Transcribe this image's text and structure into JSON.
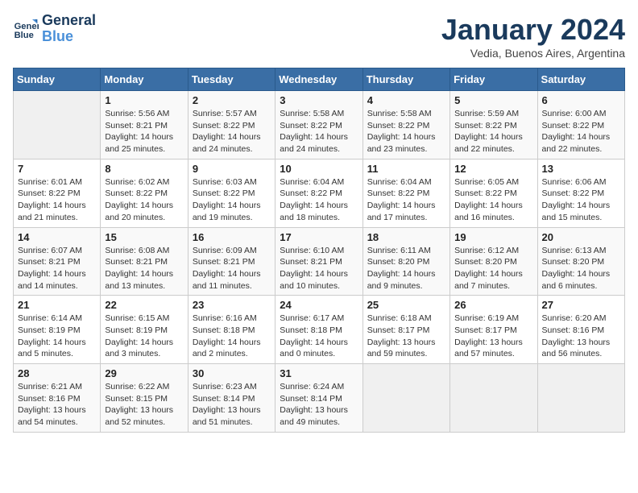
{
  "header": {
    "logo_line1": "General",
    "logo_line2": "Blue",
    "month": "January 2024",
    "location": "Vedia, Buenos Aires, Argentina"
  },
  "weekdays": [
    "Sunday",
    "Monday",
    "Tuesday",
    "Wednesday",
    "Thursday",
    "Friday",
    "Saturday"
  ],
  "weeks": [
    [
      {
        "day": "",
        "info": ""
      },
      {
        "day": "1",
        "info": "Sunrise: 5:56 AM\nSunset: 8:21 PM\nDaylight: 14 hours\nand 25 minutes."
      },
      {
        "day": "2",
        "info": "Sunrise: 5:57 AM\nSunset: 8:22 PM\nDaylight: 14 hours\nand 24 minutes."
      },
      {
        "day": "3",
        "info": "Sunrise: 5:58 AM\nSunset: 8:22 PM\nDaylight: 14 hours\nand 24 minutes."
      },
      {
        "day": "4",
        "info": "Sunrise: 5:58 AM\nSunset: 8:22 PM\nDaylight: 14 hours\nand 23 minutes."
      },
      {
        "day": "5",
        "info": "Sunrise: 5:59 AM\nSunset: 8:22 PM\nDaylight: 14 hours\nand 22 minutes."
      },
      {
        "day": "6",
        "info": "Sunrise: 6:00 AM\nSunset: 8:22 PM\nDaylight: 14 hours\nand 22 minutes."
      }
    ],
    [
      {
        "day": "7",
        "info": "Sunrise: 6:01 AM\nSunset: 8:22 PM\nDaylight: 14 hours\nand 21 minutes."
      },
      {
        "day": "8",
        "info": "Sunrise: 6:02 AM\nSunset: 8:22 PM\nDaylight: 14 hours\nand 20 minutes."
      },
      {
        "day": "9",
        "info": "Sunrise: 6:03 AM\nSunset: 8:22 PM\nDaylight: 14 hours\nand 19 minutes."
      },
      {
        "day": "10",
        "info": "Sunrise: 6:04 AM\nSunset: 8:22 PM\nDaylight: 14 hours\nand 18 minutes."
      },
      {
        "day": "11",
        "info": "Sunrise: 6:04 AM\nSunset: 8:22 PM\nDaylight: 14 hours\nand 17 minutes."
      },
      {
        "day": "12",
        "info": "Sunrise: 6:05 AM\nSunset: 8:22 PM\nDaylight: 14 hours\nand 16 minutes."
      },
      {
        "day": "13",
        "info": "Sunrise: 6:06 AM\nSunset: 8:22 PM\nDaylight: 14 hours\nand 15 minutes."
      }
    ],
    [
      {
        "day": "14",
        "info": "Sunrise: 6:07 AM\nSunset: 8:21 PM\nDaylight: 14 hours\nand 14 minutes."
      },
      {
        "day": "15",
        "info": "Sunrise: 6:08 AM\nSunset: 8:21 PM\nDaylight: 14 hours\nand 13 minutes."
      },
      {
        "day": "16",
        "info": "Sunrise: 6:09 AM\nSunset: 8:21 PM\nDaylight: 14 hours\nand 11 minutes."
      },
      {
        "day": "17",
        "info": "Sunrise: 6:10 AM\nSunset: 8:21 PM\nDaylight: 14 hours\nand 10 minutes."
      },
      {
        "day": "18",
        "info": "Sunrise: 6:11 AM\nSunset: 8:20 PM\nDaylight: 14 hours\nand 9 minutes."
      },
      {
        "day": "19",
        "info": "Sunrise: 6:12 AM\nSunset: 8:20 PM\nDaylight: 14 hours\nand 7 minutes."
      },
      {
        "day": "20",
        "info": "Sunrise: 6:13 AM\nSunset: 8:20 PM\nDaylight: 14 hours\nand 6 minutes."
      }
    ],
    [
      {
        "day": "21",
        "info": "Sunrise: 6:14 AM\nSunset: 8:19 PM\nDaylight: 14 hours\nand 5 minutes."
      },
      {
        "day": "22",
        "info": "Sunrise: 6:15 AM\nSunset: 8:19 PM\nDaylight: 14 hours\nand 3 minutes."
      },
      {
        "day": "23",
        "info": "Sunrise: 6:16 AM\nSunset: 8:18 PM\nDaylight: 14 hours\nand 2 minutes."
      },
      {
        "day": "24",
        "info": "Sunrise: 6:17 AM\nSunset: 8:18 PM\nDaylight: 14 hours\nand 0 minutes."
      },
      {
        "day": "25",
        "info": "Sunrise: 6:18 AM\nSunset: 8:17 PM\nDaylight: 13 hours\nand 59 minutes."
      },
      {
        "day": "26",
        "info": "Sunrise: 6:19 AM\nSunset: 8:17 PM\nDaylight: 13 hours\nand 57 minutes."
      },
      {
        "day": "27",
        "info": "Sunrise: 6:20 AM\nSunset: 8:16 PM\nDaylight: 13 hours\nand 56 minutes."
      }
    ],
    [
      {
        "day": "28",
        "info": "Sunrise: 6:21 AM\nSunset: 8:16 PM\nDaylight: 13 hours\nand 54 minutes."
      },
      {
        "day": "29",
        "info": "Sunrise: 6:22 AM\nSunset: 8:15 PM\nDaylight: 13 hours\nand 52 minutes."
      },
      {
        "day": "30",
        "info": "Sunrise: 6:23 AM\nSunset: 8:14 PM\nDaylight: 13 hours\nand 51 minutes."
      },
      {
        "day": "31",
        "info": "Sunrise: 6:24 AM\nSunset: 8:14 PM\nDaylight: 13 hours\nand 49 minutes."
      },
      {
        "day": "",
        "info": ""
      },
      {
        "day": "",
        "info": ""
      },
      {
        "day": "",
        "info": ""
      }
    ]
  ]
}
